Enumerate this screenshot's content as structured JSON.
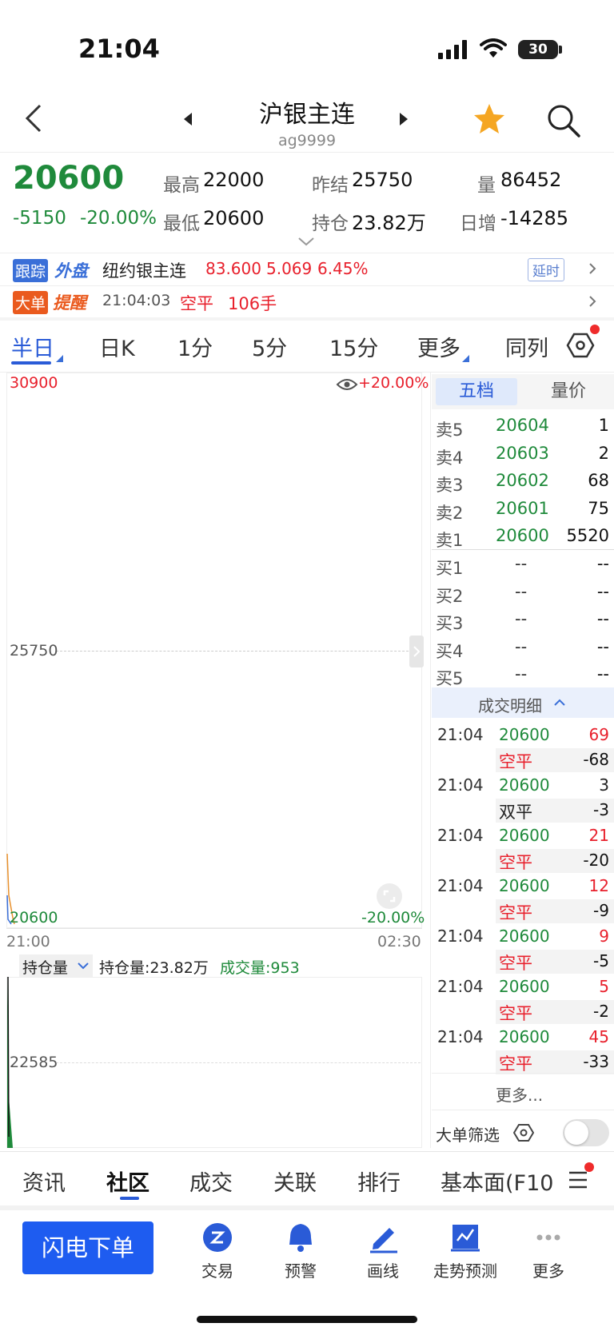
{
  "status": {
    "time": "21:04",
    "battery": "30"
  },
  "header": {
    "title": "沪银主连",
    "code": "ag9999"
  },
  "quote": {
    "price": "20600",
    "change": "-5150",
    "change_pct": "-20.00%",
    "high_label": "最高",
    "high": "22000",
    "low_label": "最低",
    "low": "20600",
    "prev_settle_label": "昨结",
    "prev_settle": "25750",
    "open_interest_label": "持仓",
    "open_interest": "23.82万",
    "volume_label": "量",
    "volume": "86452",
    "daily_inc_label": "日增",
    "daily_inc": "-14285"
  },
  "tracker": {
    "badge1": "跟踪",
    "badge2": "外盘",
    "name": "纽约银主连",
    "price": "83.600",
    "change": "5.069",
    "pct": "6.45%",
    "delay": "延时"
  },
  "big_order": {
    "badge1": "大单",
    "badge2": "提醒",
    "time": "21:04:03",
    "type": "空平",
    "qty": "106手"
  },
  "tabs": [
    "半日",
    "日K",
    "1分",
    "5分",
    "15分",
    "更多",
    "同列"
  ],
  "chart": {
    "top_price": "30900",
    "top_pct": "+20.00%",
    "mid_price": "25750",
    "low_price": "20600",
    "low_pct": "-20.00%",
    "time_start": "21:00",
    "time_end": "02:30",
    "sub_selector": "持仓量",
    "sub_oi_label": "持仓量:23.82万",
    "sub_vol_label": "成交量:953",
    "sub_mid": "22585"
  },
  "orderbook": {
    "tab_active": "五档",
    "tab_other": "量价",
    "asks": [
      {
        "label": "卖5",
        "price": "20604",
        "vol": "1"
      },
      {
        "label": "卖4",
        "price": "20603",
        "vol": "2"
      },
      {
        "label": "卖3",
        "price": "20602",
        "vol": "68"
      },
      {
        "label": "卖2",
        "price": "20601",
        "vol": "75"
      },
      {
        "label": "卖1",
        "price": "20600",
        "vol": "5520"
      }
    ],
    "bids": [
      {
        "label": "买1",
        "price": "--",
        "vol": "--"
      },
      {
        "label": "买2",
        "price": "--",
        "vol": "--"
      },
      {
        "label": "买3",
        "price": "--",
        "vol": "--"
      },
      {
        "label": "买4",
        "price": "--",
        "vol": "--"
      },
      {
        "label": "买5",
        "price": "--",
        "vol": "--"
      }
    ],
    "detail_header": "成交明细",
    "trades": [
      {
        "time": "21:04",
        "price": "20600",
        "vol": "69",
        "type": "空平",
        "chg": "-68"
      },
      {
        "time": "21:04",
        "price": "20600",
        "vol": "3",
        "type": "双平",
        "chg": "-3"
      },
      {
        "time": "21:04",
        "price": "20600",
        "vol": "21",
        "type": "空平",
        "chg": "-20"
      },
      {
        "time": "21:04",
        "price": "20600",
        "vol": "12",
        "type": "空平",
        "chg": "-9"
      },
      {
        "time": "21:04",
        "price": "20600",
        "vol": "9",
        "type": "空平",
        "chg": "-5"
      },
      {
        "time": "21:04",
        "price": "20600",
        "vol": "5",
        "type": "空平",
        "chg": "-2"
      },
      {
        "time": "21:04",
        "price": "20600",
        "vol": "45",
        "type": "空平",
        "chg": "-33"
      }
    ],
    "more": "更多...",
    "big_filter": "大单筛选"
  },
  "bottom_tabs": [
    "资讯",
    "社区",
    "成交",
    "关联",
    "排行",
    "基本面(F10"
  ],
  "toolbar": {
    "flash": "闪电下单",
    "items": [
      "交易",
      "预警",
      "画线",
      "走势预测",
      "更多"
    ]
  },
  "colors": {
    "up": "#e8202c",
    "down": "#1f8a3b",
    "accent": "#1e5cf0"
  }
}
